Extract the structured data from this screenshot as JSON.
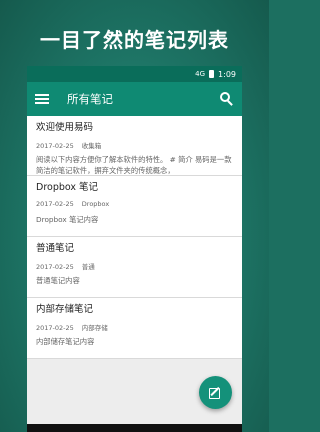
{
  "promo": {
    "headline": "一目了然的笔记列表"
  },
  "statusbar": {
    "signal": "4G",
    "time": "1:09"
  },
  "appbar": {
    "title": "所有笔记"
  },
  "notes": [
    {
      "title": "欢迎使用易码",
      "date": "2017-02-25",
      "category": "收集箱",
      "preview": "阅读以下内容方便你了解本软件的特性。 # 简介 易码是一款简洁的笔记软件，摒弃文件夹的传统概念，"
    },
    {
      "title": "Dropbox 笔记",
      "date": "2017-02-25",
      "category": "Dropbox",
      "preview": "Dropbox 笔记内容"
    },
    {
      "title": "普通笔记",
      "date": "2017-02-25",
      "category": "普通",
      "preview": "普通笔记内容"
    },
    {
      "title": "内部存储笔记",
      "date": "2017-02-25",
      "category": "内部存储",
      "preview": "内部储存笔记内容"
    }
  ],
  "colors": {
    "primary": "#0f8a73",
    "status": "#0a6d5a",
    "background": "#1c6f60",
    "fab": "#14917a"
  },
  "icons": {
    "menu": "menu-icon",
    "search": "search-icon",
    "fab": "edit-icon"
  }
}
